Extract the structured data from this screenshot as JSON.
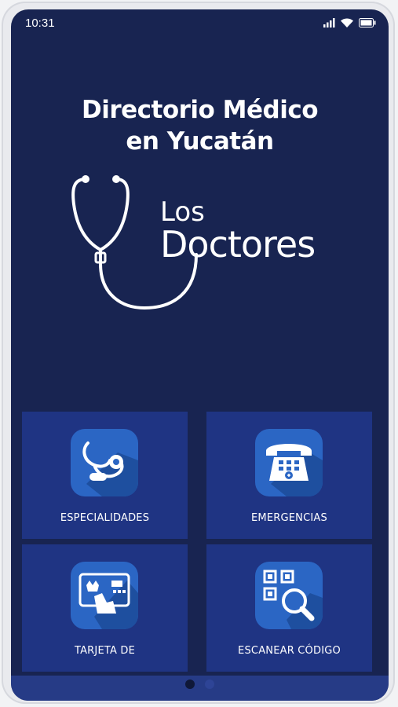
{
  "status_bar": {
    "time": "10:31"
  },
  "header": {
    "title_line1": "Directorio Médico",
    "title_line2": "en Yucatán"
  },
  "logo": {
    "text_top": "Los",
    "text_bottom": "Doctores"
  },
  "tiles": [
    {
      "label": "ESPECIALIDADES",
      "icon": "stethoscope-icon"
    },
    {
      "label": "EMERGENCIAS",
      "icon": "telephone-icon"
    },
    {
      "label": "TARJETA DE",
      "icon": "card-icon"
    },
    {
      "label": "ESCANEAR CÓDIGO",
      "icon": "qr-search-icon"
    }
  ],
  "pager": {
    "active_index": 0,
    "count": 2
  },
  "colors": {
    "background": "#182451",
    "tile": "#1f3483",
    "icon_box": "#2b66c4"
  }
}
